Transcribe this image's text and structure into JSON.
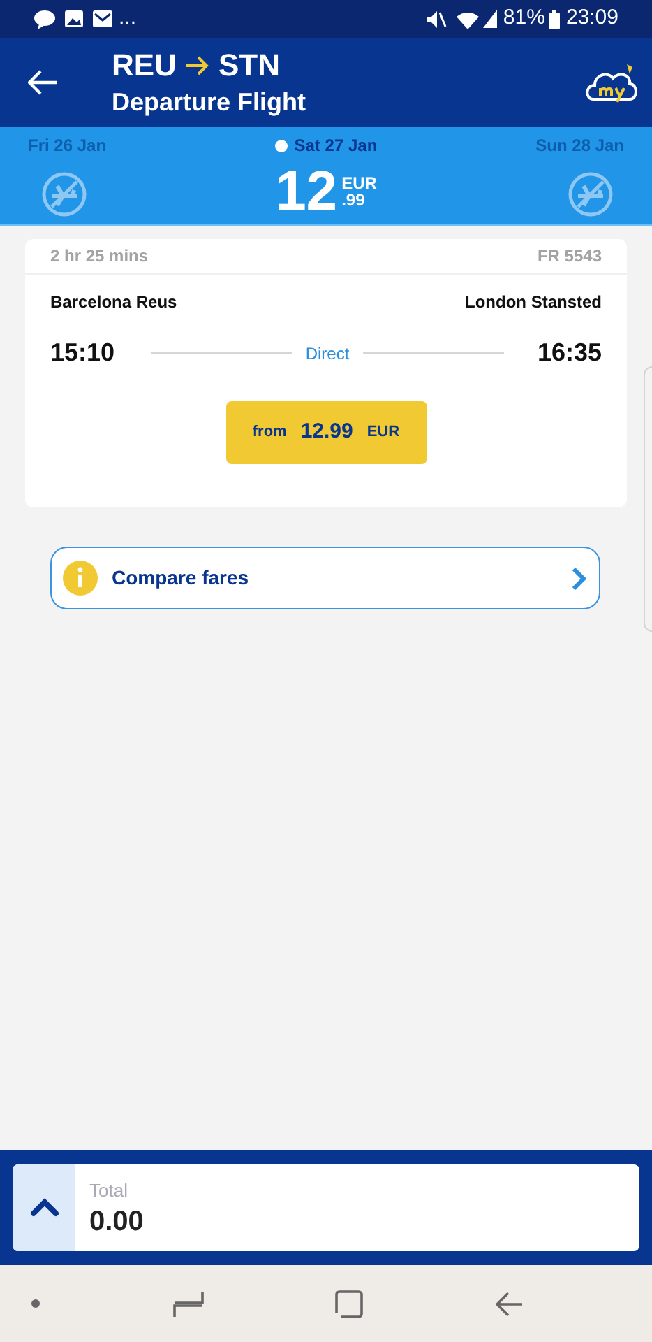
{
  "status_bar": {
    "more": "...",
    "battery": "81%",
    "time": "23:09"
  },
  "header": {
    "origin": "REU",
    "destination": "STN",
    "subtitle": "Departure Flight"
  },
  "dates": [
    {
      "label": "Fri 26 Jan",
      "selected": false,
      "kind": "no_flight"
    },
    {
      "label": "Sat 27 Jan",
      "selected": true,
      "kind": "price",
      "price_main": "12",
      "currency": "EUR",
      "price_cents": ".99"
    },
    {
      "label": "Sun 28 Jan",
      "selected": false,
      "kind": "no_flight"
    }
  ],
  "flight": {
    "duration": "2 hr 25 mins",
    "flight_number": "FR 5543",
    "from_airport": "Barcelona Reus",
    "to_airport": "London Stansted",
    "depart": "15:10",
    "stops": "Direct",
    "arrive": "16:35",
    "fare_prefix": "from",
    "fare": "12.99",
    "fare_currency": "EUR"
  },
  "compare_fares": "Compare fares",
  "total": {
    "label": "Total",
    "value": "0.00"
  }
}
